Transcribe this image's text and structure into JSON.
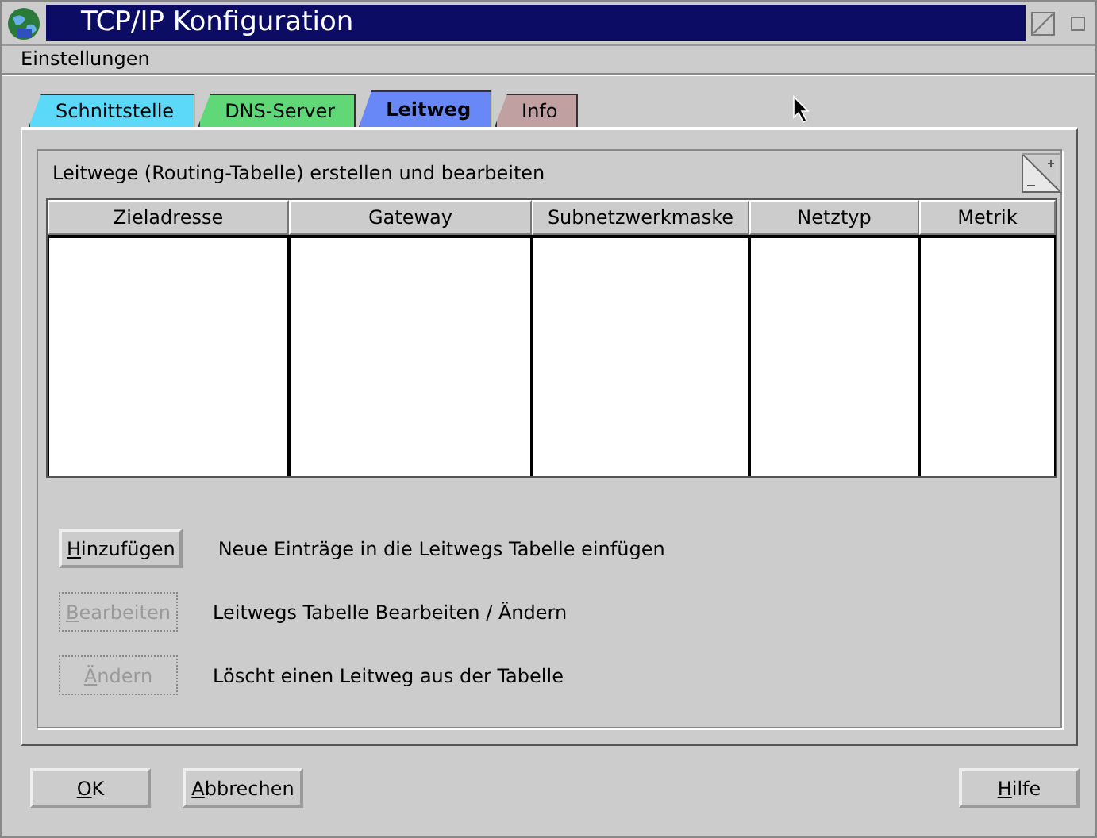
{
  "window": {
    "title": "TCP/IP Konfiguration"
  },
  "menu": [
    "Einstellungen"
  ],
  "tabs": [
    {
      "label": "Schnittstelle",
      "selected": false,
      "color": "#5cd8f8"
    },
    {
      "label": "DNS-Server",
      "selected": false,
      "color": "#60d878"
    },
    {
      "label": "Leitweg",
      "selected": true,
      "color": "#6888f8"
    },
    {
      "label": "Info",
      "selected": false,
      "color": "#c0a0a0"
    }
  ],
  "group": {
    "title": "Leitwege (Routing-Tabelle) erstellen und bearbeiten"
  },
  "table": {
    "columns": [
      "Zieladresse",
      "Gateway",
      "Subnetzwerkmaske",
      "Netztyp",
      "Metrik"
    ]
  },
  "actions": [
    {
      "button": "Hinzufügen",
      "disabled": false,
      "description": "Neue Einträge in die Leitwegs Tabelle einfügen"
    },
    {
      "button": "Bearbeiten",
      "disabled": true,
      "description": "Leitwegs Tabelle Bearbeiten / Ändern"
    },
    {
      "button": "Ändern",
      "disabled": true,
      "description": "Löscht einen Leitweg aus der Tabelle"
    }
  ],
  "buttons": [
    "OK",
    "Abbrechen"
  ],
  "help_button": "Hilfe"
}
